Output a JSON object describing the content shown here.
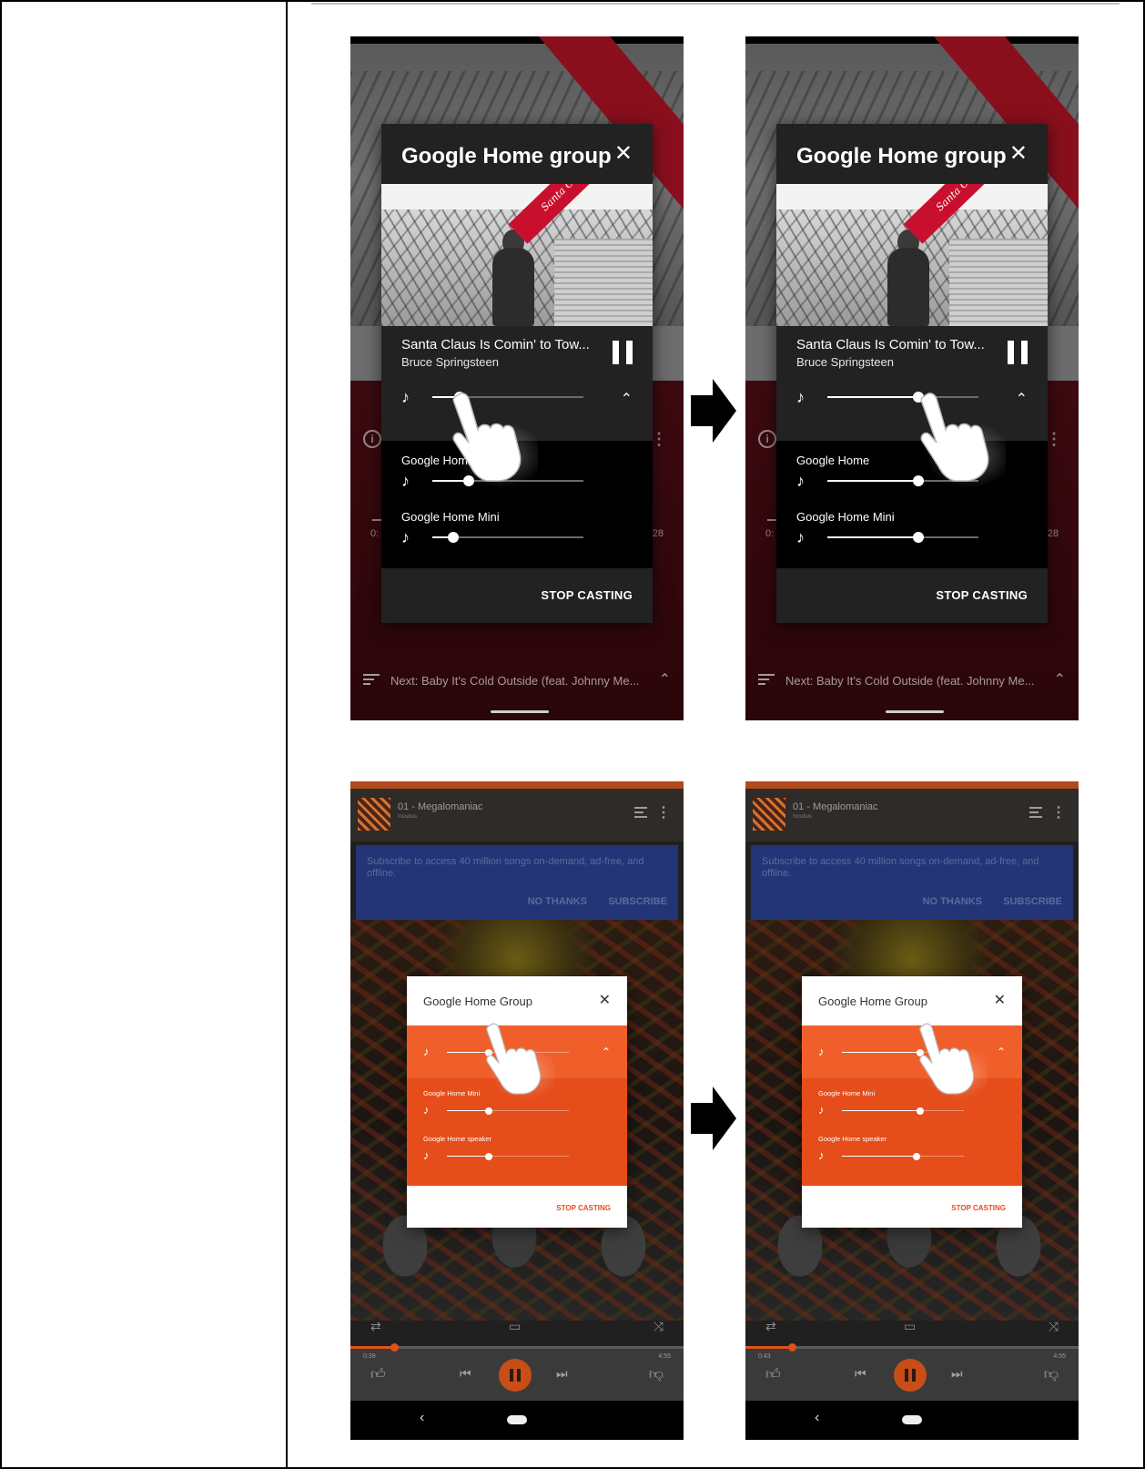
{
  "top_dialog": {
    "title": "Google Home group",
    "close_glyph": "✕",
    "album_banner": "Santa Claus Is Comin' To Town",
    "track_title": "Santa Claus Is Comin' to Tow...",
    "track_artist": "Bruce Springsteen",
    "devices": [
      "Google Home",
      "Google Home Mini"
    ],
    "stop_label": "STOP CASTING"
  },
  "top_player": {
    "next_text": "Next: Baby It's Cold Outside (feat. Johnny Me...",
    "time_left": "0:",
    "time_right": "28"
  },
  "top_before": {
    "group_volume": 0.18,
    "device_volumes": [
      0.24,
      0.14
    ]
  },
  "top_after": {
    "group_volume": 0.6,
    "device_volumes": [
      0.6,
      0.6
    ]
  },
  "bottom_player": {
    "song_title": "01 - Megalomaniac",
    "song_artist": "Incubus",
    "banner_text": "Subscribe to access 40 million songs on-demand, ad-free, and offline.",
    "no_thanks": "NO THANKS",
    "subscribe": "SUBSCRIBE",
    "time_total": "4:55"
  },
  "bottom_dialog": {
    "title": "Google Home Group",
    "close_glyph": "✕",
    "devices": [
      "Google Home Mini",
      "Google Home speaker"
    ],
    "stop_label": "STOP CASTING"
  },
  "bottom_before": {
    "group_volume": 0.34,
    "device_volumes": [
      0.34,
      0.34
    ],
    "elapsed": "0:39",
    "seek": 0.13
  },
  "bottom_after": {
    "group_volume": 0.64,
    "device_volumes": [
      0.64,
      0.61
    ],
    "elapsed": "0:43",
    "seek": 0.14
  },
  "colors": {
    "accent_orange": "#e54d1b",
    "brand_red": "#c8102e",
    "banner_blue": "#233576"
  },
  "icons": [
    "close-icon",
    "pause-icon",
    "music-note-icon",
    "chevron-up-icon",
    "info-icon",
    "queue-icon",
    "hand-pointer-icon",
    "arrow-right-icon",
    "repeat-icon",
    "cast-icon",
    "shuffle-icon",
    "thumbs-up-icon",
    "skip-previous-icon",
    "skip-next-icon",
    "thumbs-down-icon",
    "back-icon"
  ]
}
